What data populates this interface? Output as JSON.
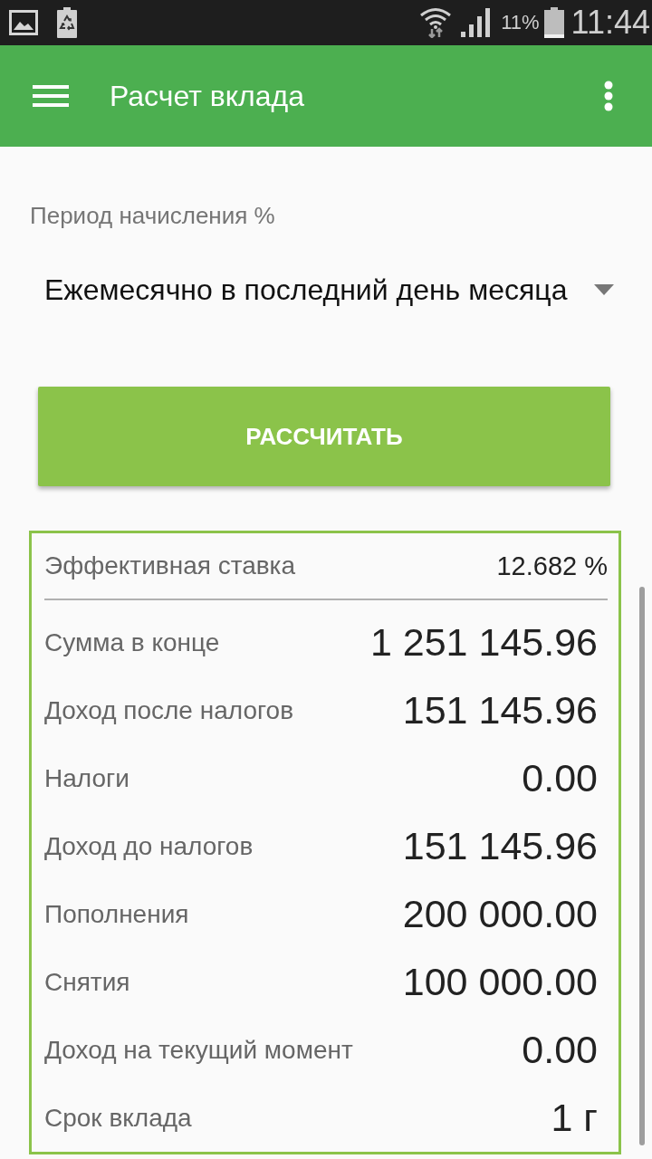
{
  "status_bar": {
    "battery_percent": "11%",
    "time": "11:44"
  },
  "app_bar": {
    "title": "Расчет вклада"
  },
  "accrual_period": {
    "label": "Период начисления %",
    "value": "Ежемесячно в последний день месяца"
  },
  "calculate_button": {
    "label": "РАССЧИТАТЬ"
  },
  "results": {
    "effective_rate": {
      "label": "Эффективная ставка",
      "value": "12.682 %"
    },
    "rows": [
      {
        "label": "Сумма в конце",
        "value": "1 251 145.96"
      },
      {
        "label": "Доход после налогов",
        "value": "151 145.96"
      },
      {
        "label": "Налоги",
        "value": "0.00"
      },
      {
        "label": "Доход до налогов",
        "value": "151 145.96"
      },
      {
        "label": "Пополнения",
        "value": "200 000.00"
      },
      {
        "label": "Снятия",
        "value": "100 000.00"
      },
      {
        "label": "Доход на текущий момент",
        "value": "0.00"
      },
      {
        "label": "Срок вклада",
        "value": "1 г"
      }
    ]
  }
}
